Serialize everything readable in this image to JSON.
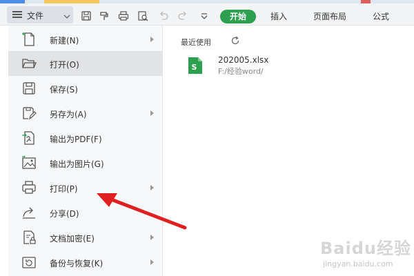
{
  "toolbar": {
    "file_label": "文件",
    "tabs": [
      {
        "label": "开始",
        "active": true
      },
      {
        "label": "插入",
        "active": false
      },
      {
        "label": "页面布局",
        "active": false
      },
      {
        "label": "公式",
        "active": false
      }
    ]
  },
  "menu": {
    "items": [
      {
        "label": "新建(N)",
        "icon": "new-file-icon",
        "submenu": true
      },
      {
        "label": "打开(O)",
        "icon": "folder-open-icon",
        "submenu": false,
        "highlight": true
      },
      {
        "label": "保存(S)",
        "icon": "save-icon",
        "submenu": false
      },
      {
        "label": "另存为(A)",
        "icon": "save-as-icon",
        "submenu": true
      },
      {
        "label": "输出为PDF(F)",
        "icon": "export-pdf-icon",
        "submenu": false
      },
      {
        "label": "输出为图片(G)",
        "icon": "export-image-icon",
        "submenu": false
      },
      {
        "label": "打印(P)",
        "icon": "printer-icon",
        "submenu": true
      },
      {
        "label": "分享(D)",
        "icon": "share-icon",
        "submenu": false
      },
      {
        "label": "文档加密(E)",
        "icon": "document-encrypt-icon",
        "submenu": true
      },
      {
        "label": "备份与恢复(K)",
        "icon": "backup-restore-icon",
        "submenu": true
      }
    ]
  },
  "recent": {
    "title": "最近使用",
    "files": [
      {
        "name": "202005.xlsx",
        "path": "F:/经验word/"
      }
    ]
  },
  "watermark": {
    "text": "Baidu经验",
    "sub": "jingyan.baidu.com"
  },
  "colors": {
    "accent_green": "#2da04f",
    "annotation_red": "#e02020"
  }
}
